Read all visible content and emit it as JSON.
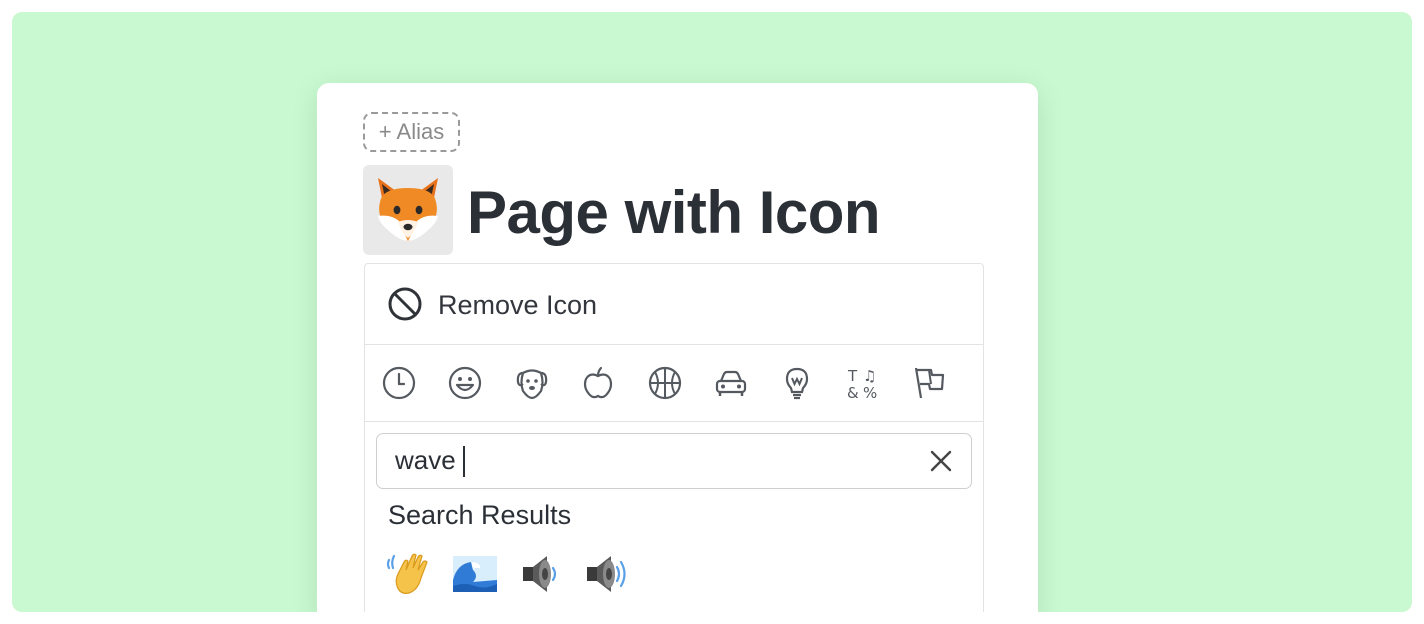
{
  "colors": {
    "background": "#c8f9d0",
    "card": "#ffffff",
    "title": "#2b2f36",
    "muted": "#8a8a8a",
    "icon_stroke": "#555a60"
  },
  "alias": {
    "label": "+ Alias"
  },
  "page": {
    "icon": "fox-emoji",
    "title": "Page with Icon"
  },
  "picker": {
    "remove_label": "Remove Icon",
    "categories": [
      "recent-clock-icon",
      "smileys-icon",
      "animals-dog-icon",
      "food-apple-icon",
      "activity-ball-icon",
      "travel-car-icon",
      "objects-bulb-icon",
      "symbols-icon",
      "flags-icon"
    ],
    "search": {
      "value": "wave",
      "placeholder": ""
    },
    "results_heading": "Search Results",
    "results": [
      "waving-hand-emoji",
      "water-wave-emoji",
      "speaker-medium-volume-emoji",
      "speaker-high-volume-emoji"
    ]
  }
}
